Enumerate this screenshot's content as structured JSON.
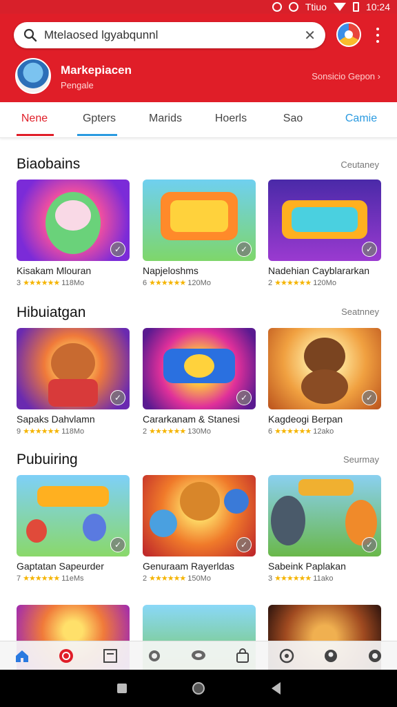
{
  "status_bar": {
    "label": "Ttiuo",
    "time": "10:24"
  },
  "search": {
    "value": "Mtelaosed lgyabqunnl",
    "clear_icon": "close-icon",
    "search_icon": "search-icon"
  },
  "header": {
    "store_name": "Markepiacen",
    "store_sub": "Pengale",
    "link": "Sonsicio Gepon"
  },
  "tabs": [
    {
      "label": "Nene",
      "active": true
    },
    {
      "label": "Gpters",
      "active": false
    },
    {
      "label": "Marids",
      "active": false
    },
    {
      "label": "Hoerls",
      "active": false
    },
    {
      "label": "Sao",
      "active": false
    },
    {
      "label": "Camie",
      "active": false
    }
  ],
  "sections": [
    {
      "title": "Biaobains",
      "more": "Ceutaney",
      "cards": [
        {
          "title": "Kisakam Mlouran",
          "rating": "3",
          "size": "118Mo"
        },
        {
          "title": "Napjeloshms",
          "rating": "6",
          "size": "120Mo"
        },
        {
          "title": "Nadehian Cayblararkan",
          "rating": "2",
          "size": "120Mo"
        }
      ]
    },
    {
      "title": "Hibuiatgan",
      "more": "Seatnney",
      "cards": [
        {
          "title": "Sapaks Dahvlamn",
          "rating": "9",
          "size": "118Mo"
        },
        {
          "title": "Cararkanam & Stanesi",
          "rating": "2",
          "size": "130Mo"
        },
        {
          "title": "Kagdeogi Berpan",
          "rating": "6",
          "size": "12ako"
        }
      ]
    },
    {
      "title": "Pubuiring",
      "more": "Seurmay",
      "cards": [
        {
          "title": "Gaptatan Sapeurder",
          "rating": "7",
          "size": "11eMs"
        },
        {
          "title": "Genuraam Rayerldas",
          "rating": "2",
          "size": "150Mo"
        },
        {
          "title": "Sabeink Paplakan",
          "rating": "3",
          "size": "11ako"
        }
      ]
    }
  ],
  "star_glyphs": "★★★★★★",
  "colors": {
    "brand_red": "#e01e28",
    "tab_accent_blue": "#2a9ae0",
    "star": "#f5b400"
  }
}
